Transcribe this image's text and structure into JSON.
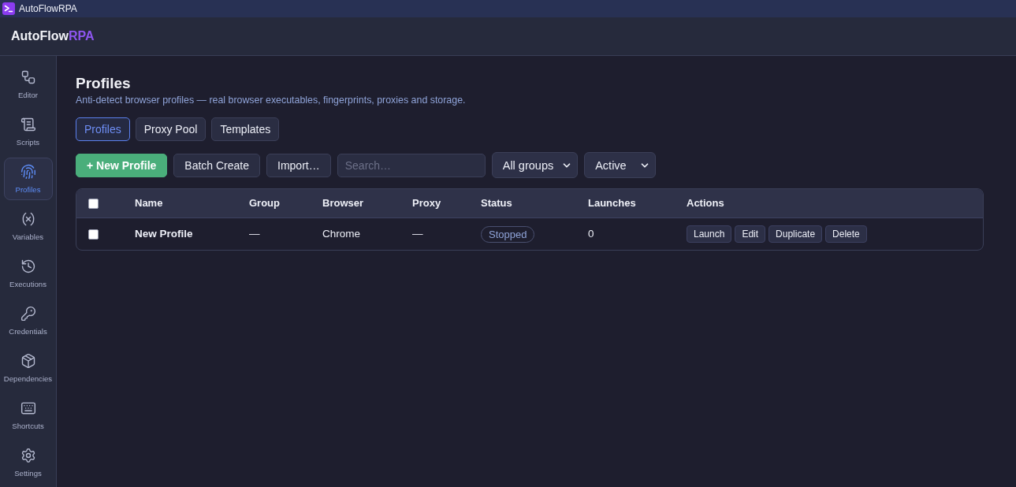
{
  "window": {
    "title": "AutoFlowRPA"
  },
  "header": {
    "brand": "AutoFlow",
    "brand_accent": "RPA"
  },
  "sidebar": {
    "items": [
      {
        "label": "Editor",
        "selected": false
      },
      {
        "label": "Scripts",
        "selected": false
      },
      {
        "label": "Profiles",
        "selected": true
      },
      {
        "label": "Variables",
        "selected": false
      },
      {
        "label": "Executions",
        "selected": false
      },
      {
        "label": "Credentials",
        "selected": false
      },
      {
        "label": "Dependencies",
        "selected": false
      },
      {
        "label": "Shortcuts",
        "selected": false
      },
      {
        "label": "Settings",
        "selected": false
      }
    ]
  },
  "page": {
    "title": "Profiles",
    "subtitle": "Anti-detect browser profiles — real browser executables, fingerprints, proxies and storage."
  },
  "tabs": [
    {
      "label": "Profiles",
      "selected": true
    },
    {
      "label": "Proxy Pool",
      "selected": false
    },
    {
      "label": "Templates",
      "selected": false
    }
  ],
  "toolbar": {
    "buttons": [
      {
        "label": "+ New Profile",
        "kind": "primary"
      },
      {
        "label": "Batch Create",
        "kind": "secondary"
      },
      {
        "label": "Import…",
        "kind": "secondary"
      }
    ],
    "search": {
      "placeholder": "Search…"
    },
    "filters": [
      {
        "value": "All groups"
      },
      {
        "value": "Active"
      }
    ]
  },
  "table": {
    "select_all_checked": false,
    "columns": [
      "Name",
      "Group",
      "Browser",
      "Proxy",
      "Status",
      "Launches",
      "Actions"
    ],
    "rows": [
      {
        "checked": false,
        "name": "New Profile",
        "group": "—",
        "browser": "Chrome",
        "proxy": "—",
        "status": "Stopped",
        "launches": "0",
        "actions": [
          "Launch",
          "Edit",
          "Duplicate",
          "Delete"
        ]
      }
    ]
  }
}
